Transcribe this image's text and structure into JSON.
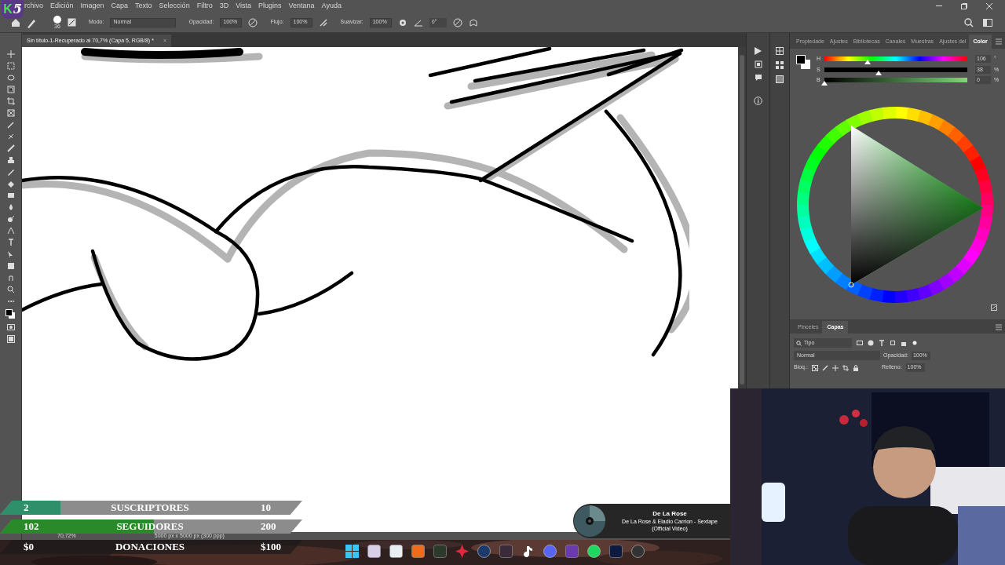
{
  "logo": {
    "letter": "K",
    "number": "5"
  },
  "menu": [
    "rchivo",
    "Edición",
    "Imagen",
    "Capa",
    "Texto",
    "Selección",
    "Filtro",
    "3D",
    "Vista",
    "Plugins",
    "Ventana",
    "Ayuda"
  ],
  "options_bar": {
    "brush_size": "36",
    "mode_label": "Modo:",
    "mode": "Normal",
    "opacity_label": "Opacidad:",
    "opacity": "100%",
    "flow_label": "Flujo:",
    "flow": "100%",
    "smoothing_label": "Suavizar:",
    "smoothing": "100%",
    "angle": "0°"
  },
  "document_tab": {
    "title": "Sin título-1-Recuperado al 70,7% (Capa 5, RGB/8) *",
    "close": "×"
  },
  "color_panel": {
    "tabs": [
      {
        "label": "Propiedade",
        "selected": false
      },
      {
        "label": "Ajustes",
        "selected": false
      },
      {
        "label": "Bibliotecas",
        "selected": false
      },
      {
        "label": "Canales",
        "selected": false
      },
      {
        "label": "Muestras",
        "selected": false
      },
      {
        "label": "Ajustes del",
        "selected": false
      },
      {
        "label": "Color",
        "selected": true
      }
    ],
    "sliders": [
      {
        "label": "H",
        "value": "106",
        "unit": "°",
        "level": 0.3
      },
      {
        "label": "S",
        "value": "38",
        "unit": "%",
        "level": 0.38
      },
      {
        "label": "B",
        "value": "0",
        "unit": "%",
        "level": 0
      }
    ]
  },
  "layers_panel": {
    "tabs": [
      {
        "label": "Pinceles",
        "selected": false
      },
      {
        "label": "Capas",
        "selected": true
      }
    ],
    "filter": "Tipo",
    "blend_mode": "Normal",
    "opacity_label": "Opacidad:",
    "opacity": "100%",
    "lock_label": "Bloq.:",
    "fill_label": "Relleno:",
    "fill": "100%"
  },
  "status_bar": {
    "zoom": "70,72%",
    "size": "5000 px x 5000 px (300 ppp)"
  },
  "stream_goals": [
    {
      "label": "SUSCRIPTORES",
      "current": "2",
      "target": "10",
      "level": 0.2,
      "color": "#2f8f6a"
    },
    {
      "label": "SEGUIDORES",
      "current": "102",
      "target": "200",
      "level": 0.51,
      "color": "#2a8a2a"
    },
    {
      "label": "DONACIONES",
      "current": "$0",
      "target": "$100",
      "level": 0
    }
  ],
  "now_playing": {
    "artist": "De La Rose",
    "title": "De La Rose & Eladio Carrion - Sextape (Official Video)"
  }
}
